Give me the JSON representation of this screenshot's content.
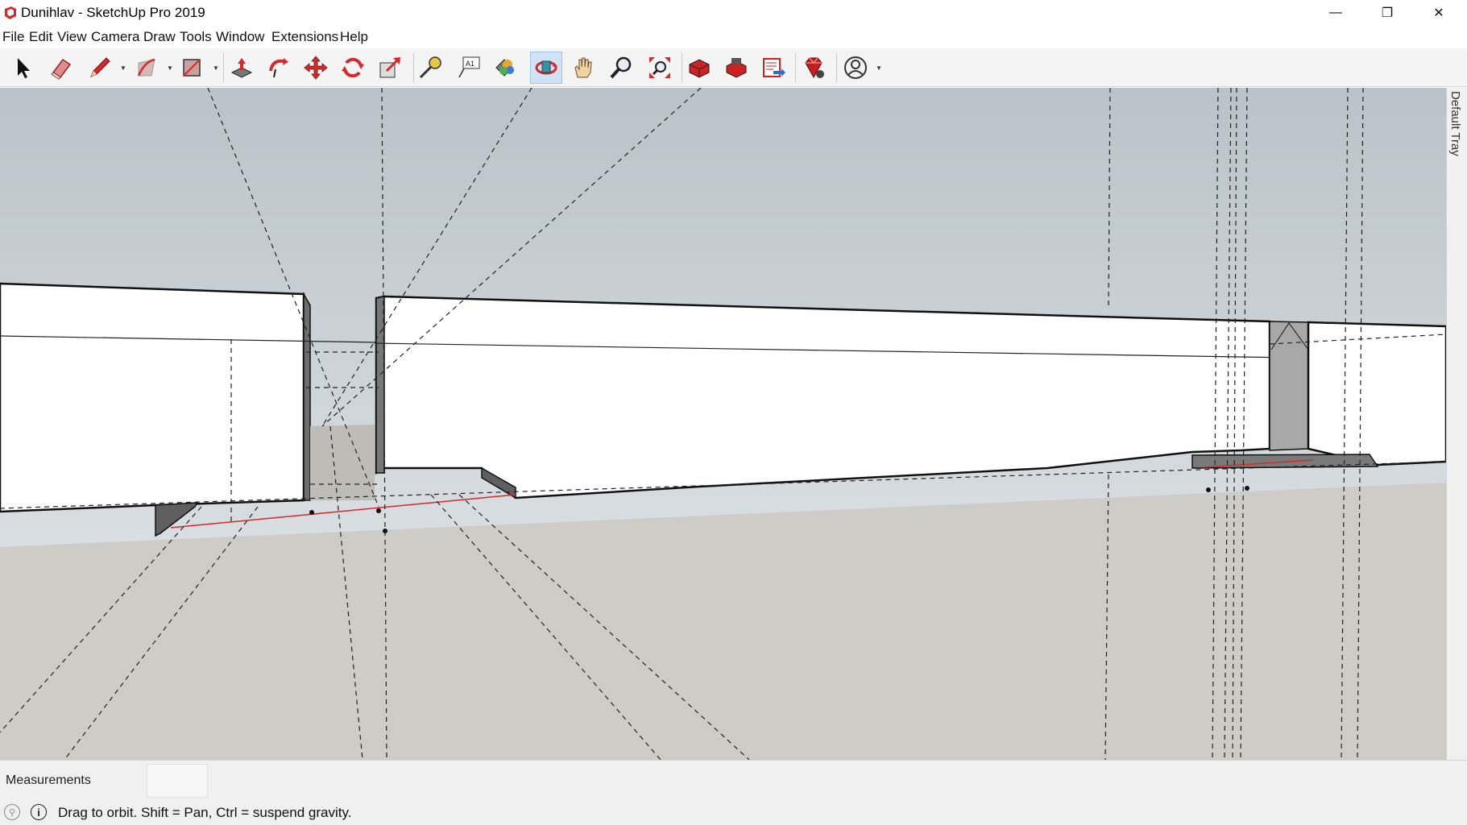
{
  "window": {
    "title": "Dunihlav - SketchUp Pro 2019",
    "controls": {
      "minimize": "—",
      "maximize": "❐",
      "close": "✕"
    }
  },
  "menu": [
    "File",
    "Edit",
    "View",
    "Camera",
    "Draw",
    "Tools",
    "Window",
    "Extensions",
    "Help"
  ],
  "toolbar": {
    "active_tool": "orbit",
    "tools": [
      "select",
      "eraser",
      "pencil",
      "arc",
      "rectangle",
      "push-pull",
      "follow-me",
      "move",
      "rotate",
      "scale",
      "tape-measure",
      "text",
      "paint-bucket",
      "orbit",
      "pan",
      "zoom",
      "zoom-extents",
      "3d-warehouse",
      "extension-warehouse",
      "send-to-layout",
      "extension-manager",
      "account"
    ]
  },
  "tray": {
    "label": "Default Tray"
  },
  "measurements": {
    "label": "Measurements",
    "value": ""
  },
  "status": {
    "message": "Drag to orbit. Shift = Pan, Ctrl = suspend gravity."
  },
  "colors": {
    "sky_top": "#b8c2c8",
    "sky_bottom": "#e6eaec",
    "ground": "#cdccc7",
    "accent": "#d42a2a"
  }
}
